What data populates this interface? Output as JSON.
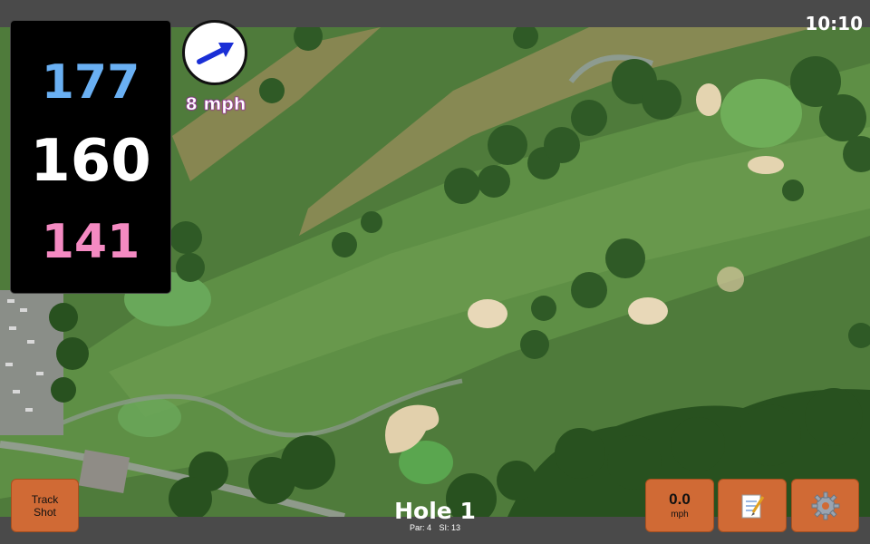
{
  "status_bar": {
    "time": "10:10"
  },
  "distances": {
    "back": "177",
    "middle": "160",
    "front": "141"
  },
  "wind": {
    "speed_text": "8 mph",
    "direction_icon": "arrow-icon"
  },
  "buttons": {
    "track_shot": "Track\nShot",
    "wind_value": "0.0",
    "wind_unit": "mph",
    "notes_icon": "notepad-icon",
    "settings_icon": "gear-icon"
  },
  "hole": {
    "title": "Hole 1",
    "par": "Par: 4",
    "si": "SI: 13"
  },
  "colors": {
    "back": "#6ab0f3",
    "middle": "#ffffff",
    "front": "#f48ac2",
    "button": "#d06a35",
    "bar": "#4a4a4a"
  }
}
